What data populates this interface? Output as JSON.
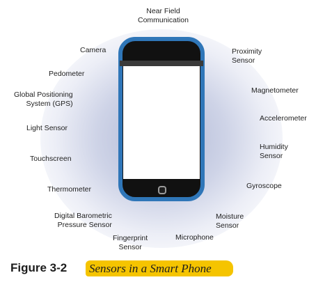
{
  "sensors": {
    "near_field": "Near Field\nCommunication",
    "camera": "Camera",
    "proximity": "Proximity\nSensor",
    "pedometer": "Pedometer",
    "magnetometer": "Magnetometer",
    "gps": "Global Positioning\nSystem (GPS)",
    "accelerometer": "Accelerometer",
    "light": "Light Sensor",
    "humidity": "Humidity\nSensor",
    "touchscreen": "Touchscreen",
    "thermometer": "Thermometer",
    "gyroscope": "Gyroscope",
    "barometric": "Digital Barometric\nPressure Sensor",
    "moisture": "Moisture\nSensor",
    "fingerprint": "Fingerprint\nSensor",
    "microphone": "Microphone"
  },
  "caption": {
    "number": "Figure 3-2",
    "title": "Sensors in a Smart Phone"
  },
  "colors": {
    "phone_frame": "#2f76b8",
    "highlight": "#f5c400",
    "glow": "#a0aacd"
  }
}
